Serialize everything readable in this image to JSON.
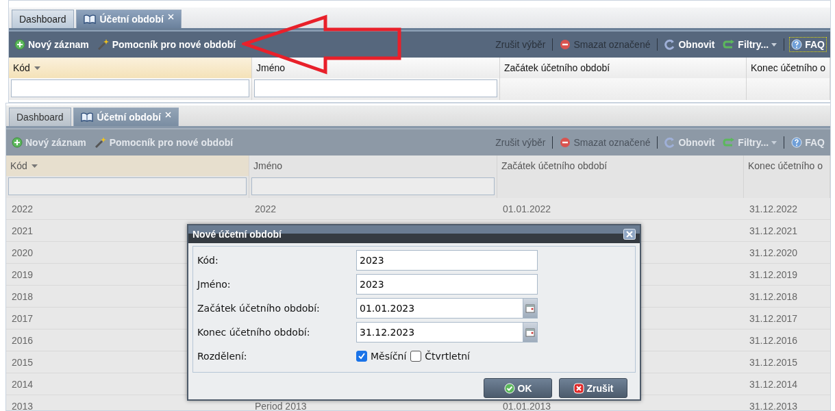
{
  "screens": [
    {
      "dimmed": false,
      "tabs": [
        {
          "label": "Dashboard",
          "selected": false,
          "icon": false
        },
        {
          "label": "Účetní období",
          "selected": true,
          "icon": true
        }
      ],
      "toolbar_left": [
        {
          "kind": "add",
          "label": "Nový záznam",
          "disabled": false
        },
        {
          "kind": "wand",
          "label": "Pomocník pro nové období",
          "disabled": false
        }
      ],
      "toolbar_right": [
        {
          "kind": "plain",
          "label": "Zrušit výběr",
          "disabled": true
        },
        {
          "kind": "separator"
        },
        {
          "kind": "delete",
          "label": "Smazat označené",
          "disabled": true
        },
        {
          "kind": "separator"
        },
        {
          "kind": "refresh",
          "label": "Obnovit",
          "disabled": false
        },
        {
          "kind": "filter",
          "label": "Filtry...",
          "disabled": false
        },
        {
          "kind": "separator"
        },
        {
          "kind": "help",
          "label": "FAQ",
          "disabled": false,
          "focused": true
        }
      ],
      "columns": [
        {
          "label": "Kód",
          "sorted": true,
          "filterable": true
        },
        {
          "label": "Jméno",
          "sorted": false,
          "filterable": true
        },
        {
          "label": "Začátek účetního období",
          "sorted": false,
          "filterable": false
        },
        {
          "label": "Konec účetního o",
          "sorted": false,
          "filterable": false
        }
      ]
    },
    {
      "dimmed": true,
      "tabs": [
        {
          "label": "Dashboard",
          "selected": false,
          "icon": false
        },
        {
          "label": "Účetní období",
          "selected": true,
          "icon": true
        }
      ],
      "toolbar_left": [
        {
          "kind": "add",
          "label": "Nový záznam",
          "disabled": false
        },
        {
          "kind": "wand",
          "label": "Pomocník pro nové období",
          "disabled": false
        }
      ],
      "toolbar_right": [
        {
          "kind": "plain",
          "label": "Zrušit výběr",
          "disabled": true
        },
        {
          "kind": "separator"
        },
        {
          "kind": "delete",
          "label": "Smazat označené",
          "disabled": true
        },
        {
          "kind": "separator"
        },
        {
          "kind": "refresh",
          "label": "Obnovit",
          "disabled": false
        },
        {
          "kind": "filter",
          "label": "Filtry...",
          "disabled": false
        },
        {
          "kind": "separator"
        },
        {
          "kind": "help",
          "label": "FAQ",
          "disabled": false,
          "focused": false
        }
      ],
      "columns": [
        {
          "label": "Kód",
          "sorted": true,
          "filterable": true
        },
        {
          "label": "Jméno",
          "sorted": false,
          "filterable": true
        },
        {
          "label": "Začátek účetního období",
          "sorted": false,
          "filterable": false
        },
        {
          "label": "Konec účetního o",
          "sorted": false,
          "filterable": false
        }
      ],
      "rows": [
        {
          "kod": "2022",
          "jmeno": "2022",
          "zacatek": "01.01.2022",
          "konec": "31.12.2022"
        },
        {
          "kod": "2021",
          "konec": "31.12.2021"
        },
        {
          "kod": "2020",
          "konec": "31.12.2020"
        },
        {
          "kod": "2019",
          "konec": "31.12.2019"
        },
        {
          "kod": "2018",
          "konec": "31.12.2018"
        },
        {
          "kod": "2017",
          "konec": "31.12.2017"
        },
        {
          "kod": "2016",
          "konec": "31.12.2016"
        },
        {
          "kod": "2015",
          "konec": "31.12.2015"
        },
        {
          "kod": "2014",
          "konec": "31.12.2014"
        },
        {
          "kod": "2013",
          "jmeno": "Period 2013",
          "zacatek": "01.01.2013",
          "konec": "31.12.2013"
        }
      ],
      "dialog": {
        "title": "Nové účetní období",
        "fields": [
          {
            "kind": "text",
            "label": "Kód:",
            "value": "2023"
          },
          {
            "kind": "text",
            "label": "Jméno:",
            "value": "2023"
          },
          {
            "kind": "date",
            "label": "Začátek účetního období:",
            "value": "01.01.2023"
          },
          {
            "kind": "date",
            "label": "Konec účetního období:",
            "value": "31.12.2023"
          }
        ],
        "split": {
          "label": "Rozdělení:",
          "options": [
            {
              "label": "Měsíční",
              "checked": true
            },
            {
              "label": "Čtvrtletní",
              "checked": false
            }
          ]
        },
        "buttons": [
          {
            "kind": "ok",
            "label": "OK"
          },
          {
            "kind": "cancel",
            "label": "Zrušit"
          }
        ]
      }
    }
  ]
}
